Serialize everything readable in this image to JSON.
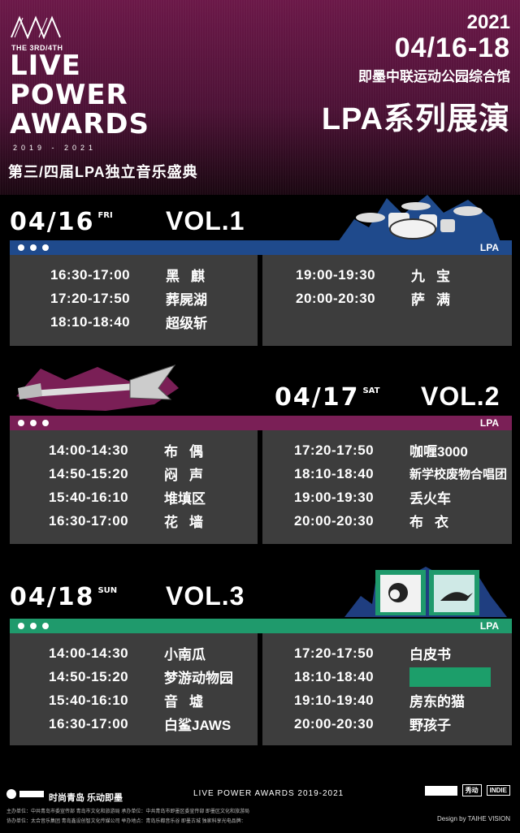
{
  "header": {
    "logo_sub": "THE 3RD/4TH",
    "logo_line1": "LIVE",
    "logo_line2": "POWER",
    "logo_line3": "AWARDS",
    "logo_years": "2019 - 2021",
    "logo_cn": "第三/四届LPA独立音乐盛典",
    "year": "2021",
    "date_range": "04/16-18",
    "venue": "即墨中联运动公园综合馆",
    "title": "LPA系列展演"
  },
  "days": [
    {
      "date": "04/16",
      "dow": "FRI",
      "vol": "VOL.1",
      "bar_label": "LPA",
      "bar_color": "#1f4a8c",
      "left": [
        {
          "time": "16:30-17:00",
          "band": "黑麒"
        },
        {
          "time": "17:20-17:50",
          "band": "葬屍湖"
        },
        {
          "time": "18:10-18:40",
          "band": "超级斩"
        }
      ],
      "right": [
        {
          "time": "19:00-19:30",
          "band": "九宝"
        },
        {
          "time": "20:00-20:30",
          "band": "萨满"
        }
      ]
    },
    {
      "date": "04/17",
      "dow": "SAT",
      "vol": "VOL.2",
      "bar_label": "LPA",
      "bar_color": "#7a1f56",
      "left": [
        {
          "time": "14:00-14:30",
          "band": "布偶"
        },
        {
          "time": "14:50-15:20",
          "band": "闷声"
        },
        {
          "time": "15:40-16:10",
          "band": "堆填区"
        },
        {
          "time": "16:30-17:00",
          "band": "花墙"
        }
      ],
      "right": [
        {
          "time": "17:20-17:50",
          "band": "咖喱3000"
        },
        {
          "time": "18:10-18:40",
          "band": "新学校废物合唱团"
        },
        {
          "time": "19:00-19:30",
          "band": "丢火车"
        },
        {
          "time": "20:00-20:30",
          "band": "布衣"
        }
      ]
    },
    {
      "date": "04/18",
      "dow": "SUN",
      "vol": "VOL.3",
      "bar_label": "LPA",
      "bar_color": "#1f9a6c",
      "left": [
        {
          "time": "14:00-14:30",
          "band": "小南瓜"
        },
        {
          "time": "14:50-15:20",
          "band": "梦游动物园"
        },
        {
          "time": "15:40-16:10",
          "band": "音墟"
        },
        {
          "time": "16:30-17:00",
          "band": "白鲨JAWS"
        }
      ],
      "right": [
        {
          "time": "17:20-17:50",
          "band": "白皮书"
        },
        {
          "time": "18:10-18:40",
          "band": ""
        },
        {
          "time": "19:10-19:40",
          "band": "房东的猫"
        },
        {
          "time": "20:00-20:30",
          "band": "野孩子"
        }
      ]
    }
  ],
  "footer": {
    "slogan": "时尚青岛 乐动即墨",
    "center": "LIVE POWER AWARDS 2019-2021",
    "line1": "主办单位：中共青岛市委宣传部  青岛市文化和旅游局    承办单位：中共青岛市即墨区委宣传部  即墨区文化和旅游局",
    "line2": "协办单位：太合音乐集团  青岛鑫设创智文化传媒公司  举办地点：青岛乐都音乐谷 即墨古城    独家科享光电品牌：",
    "design": "Design by TAIHE VISION",
    "logo1": "秀动",
    "logo2": "INDIE"
  }
}
